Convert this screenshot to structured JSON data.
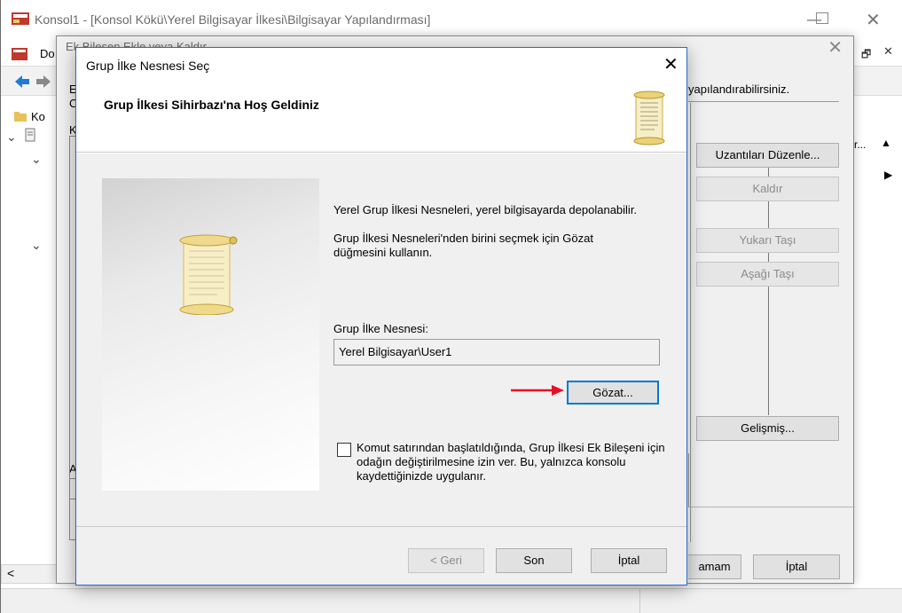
{
  "mmc": {
    "title": "Konsol1 - [Konsol Kökü\\Yerel Bilgisayar İlkesi\\Bilgisayar Yapılandırması]",
    "menu_first": "Do",
    "tree_item": "Ko",
    "description_fragment": "yapılandırabilirsiniz.",
    "status_left": "<"
  },
  "snapin": {
    "title": "Ek Bileşen Ekle veya Kaldır",
    "extensions_button": "Uzantıları Düzenle...",
    "remove_button": "Kaldır",
    "move_up_button": "Yukarı Taşı",
    "move_down_button": "Aşağı Taşı",
    "advanced_button": "Gelişmiş...",
    "ok_button": "amam",
    "cancel_button": "İptal",
    "list_header": "r...",
    "side_letters": [
      "E",
      "C",
      "K",
      "A"
    ]
  },
  "wizard": {
    "title": "Grup İlke Nesnesi Seç",
    "heading": "Grup İlkesi Sihirbazı'na Hoş Geldiniz",
    "intro_text": "Yerel Grup İlkesi Nesneleri, yerel bilgisayarda depolanabilir.",
    "browse_hint": "Grup İlkesi Nesneleri'nden birini seçmek için Gözat düğmesini kullanın.",
    "gpo_label": "Grup İlke Nesnesi:",
    "gpo_value": "Yerel Bilgisayar\\User1",
    "browse_button": "Gözat...",
    "checkbox_text": "Komut satırından başlatıldığında, Grup İlkesi Ek Bileşeni için odağın değiştirilmesine izin ver.  Bu, yalnızca konsolu kaydettiğinizde uygulanır.",
    "back_button": "< Geri",
    "finish_button": "Son",
    "cancel_button": "İptal"
  },
  "colors": {
    "accent": "#0078d7",
    "arrow": "#e81123",
    "scroll_paper": "#f5e9b0"
  }
}
